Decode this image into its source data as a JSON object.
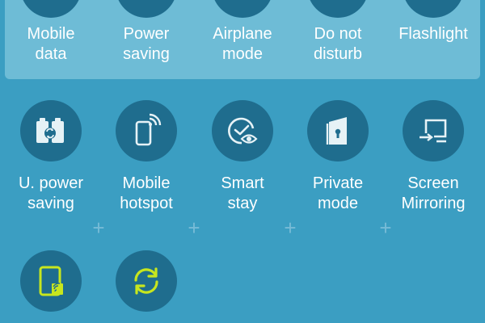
{
  "active_row": [
    {
      "label": "Mobile\ndata",
      "icon": "mobile-data-icon"
    },
    {
      "label": "Power\nsaving",
      "icon": "power-saving-icon"
    },
    {
      "label": "Airplane\nmode",
      "icon": "airplane-mode-icon"
    },
    {
      "label": "Do not\ndisturb",
      "icon": "do-not-disturb-icon"
    },
    {
      "label": "Flashlight",
      "icon": "flashlight-icon"
    }
  ],
  "available_row": [
    {
      "label": "U. power\nsaving",
      "icon": "ultra-power-saving-icon"
    },
    {
      "label": "Mobile\nhotspot",
      "icon": "mobile-hotspot-icon"
    },
    {
      "label": "Smart\nstay",
      "icon": "smart-stay-icon"
    },
    {
      "label": "Private\nmode",
      "icon": "private-mode-icon"
    },
    {
      "label": "Screen\nMirroring",
      "icon": "screen-mirroring-icon"
    }
  ],
  "extra_row": [
    {
      "icon": "nfc-tablet-icon"
    },
    {
      "icon": "sync-icon"
    }
  ],
  "add_marker": "+",
  "colors": {
    "background": "#3b9ec2",
    "active_panel": "#6ebcd6",
    "tile_circle": "#1f6d8e",
    "icon_white": "#e6f2f6",
    "icon_accent": "#c7e61e"
  }
}
